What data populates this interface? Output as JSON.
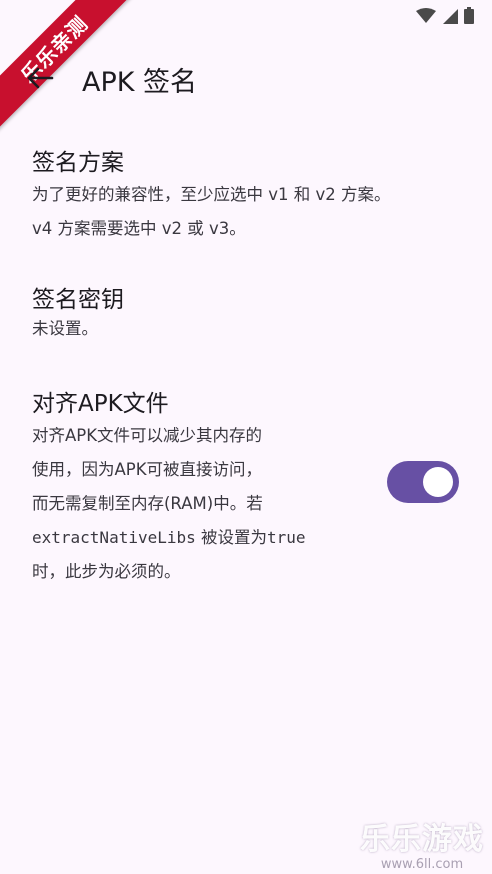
{
  "app_bar": {
    "title": "APK 签名"
  },
  "preferences": {
    "signing_scheme": {
      "title": "签名方案",
      "summary_line1": "为了更好的兼容性，至少应选中 v1 和 v2 方案。",
      "summary_line2": "v4 方案需要选中 v2 或 v3。"
    },
    "signing_key": {
      "title": "签名密钥",
      "summary": "未设置。"
    },
    "zipalign": {
      "title": "对齐APK文件",
      "summary_line1": "对齐APK文件可以减少其内存的",
      "summary_line2": "使用，因为APK可被直接访问，",
      "summary_line3": "而无需复制至内存(RAM)中。若",
      "summary_code1": "extractNativeLibs",
      "summary_mid": " 被设置为",
      "summary_code2": "true",
      "summary_line5": "时，此步为必须的。",
      "enabled": true
    }
  },
  "overlays": {
    "corner_ribbon_text": "乐乐亲测",
    "watermark_text": "乐乐游戏",
    "watermark_url": "www.6ll.com"
  },
  "colors": {
    "background": "#fdf7fe",
    "switch_on": "#6750a4",
    "ribbon": "#c8102e"
  }
}
